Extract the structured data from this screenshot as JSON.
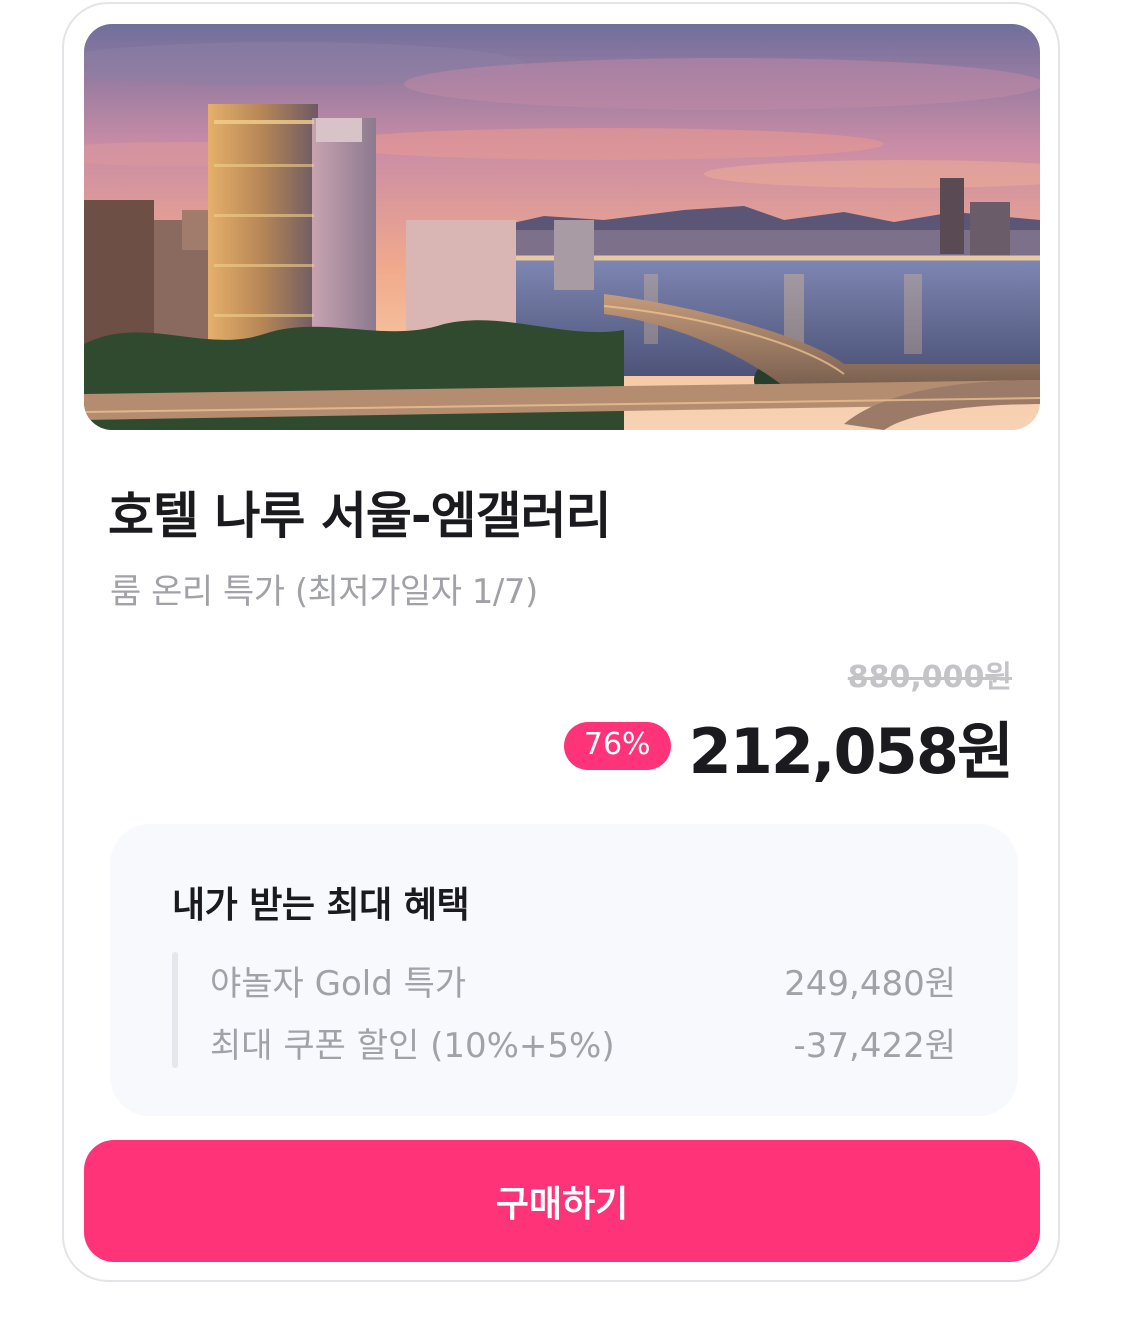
{
  "hotel": {
    "name": "호텔 나루 서울-엠갤러리",
    "subtitle": "룸 온리 특가 (최저가일자 1/7)",
    "image_alt": "Hotel building by the Han River at sunset"
  },
  "pricing": {
    "original_price": "880,000원",
    "discount_badge": "76%",
    "final_price": "212,058원"
  },
  "benefits": {
    "title": "내가 받는 최대 혜택",
    "items": [
      {
        "label": "야놀자 Gold 특가",
        "value": "249,480원"
      },
      {
        "label": "최대 쿠폰 할인 (10%+5%)",
        "value": "-37,422원"
      }
    ]
  },
  "actions": {
    "buy_label": "구매하기"
  },
  "colors": {
    "accent": "#ff3478",
    "text_primary": "#1b1b1f",
    "text_secondary": "#a1a1a8",
    "strike": "#c3c3c8",
    "benefit_bg": "#f8f9fc"
  }
}
